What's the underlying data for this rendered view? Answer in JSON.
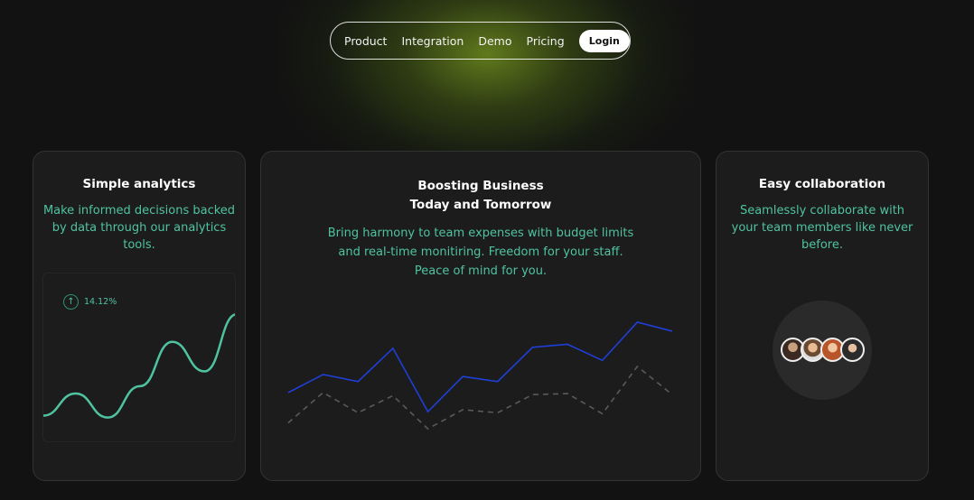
{
  "nav": {
    "items": [
      "Product",
      "Integration",
      "Demo",
      "Pricing"
    ],
    "login_label": "Login"
  },
  "cards": {
    "analytics": {
      "title": "Simple analytics",
      "description": "Make informed decisions backed by data through our analytics tools.",
      "growth_badge": "14.12%"
    },
    "business": {
      "title_line1": "Boosting Business",
      "title_line2": "Today and Tomorrow",
      "description_line1": "Bring harmony to team expenses with budget limits",
      "description_line2": "and real-time monitiring. Freedom for your staff.",
      "description_line3": "Peace of mind for you."
    },
    "collaboration": {
      "title": "Easy collaboration",
      "description": "Seamlessly collaborate with your team members like never before.",
      "avatar_count": 4
    }
  },
  "colors": {
    "accent": "#4fc3a1",
    "series_primary": "#1f3fd6",
    "series_secondary": "#5a5a5a",
    "glow": "#6e8c1e"
  },
  "chart_data": [
    {
      "type": "line",
      "title": "",
      "series": [
        {
          "values": [
            20,
            44,
            18,
            52,
            100,
            68,
            130
          ]
        }
      ],
      "x": [
        0,
        1,
        2,
        3,
        4,
        5,
        6
      ]
    },
    {
      "type": "line",
      "x": [
        0,
        1,
        2,
        3,
        4,
        5,
        6,
        7,
        8,
        9,
        10,
        11,
        12
      ],
      "series": [
        {
          "style": "solid",
          "values": [
            52,
            70,
            63,
            96,
            33,
            68,
            63,
            97,
            100,
            84,
            122,
            113
          ]
        },
        {
          "style": "dashed",
          "values": [
            22,
            52,
            32,
            49,
            16,
            35,
            32,
            50,
            51,
            31,
            78,
            50
          ]
        }
      ]
    }
  ]
}
